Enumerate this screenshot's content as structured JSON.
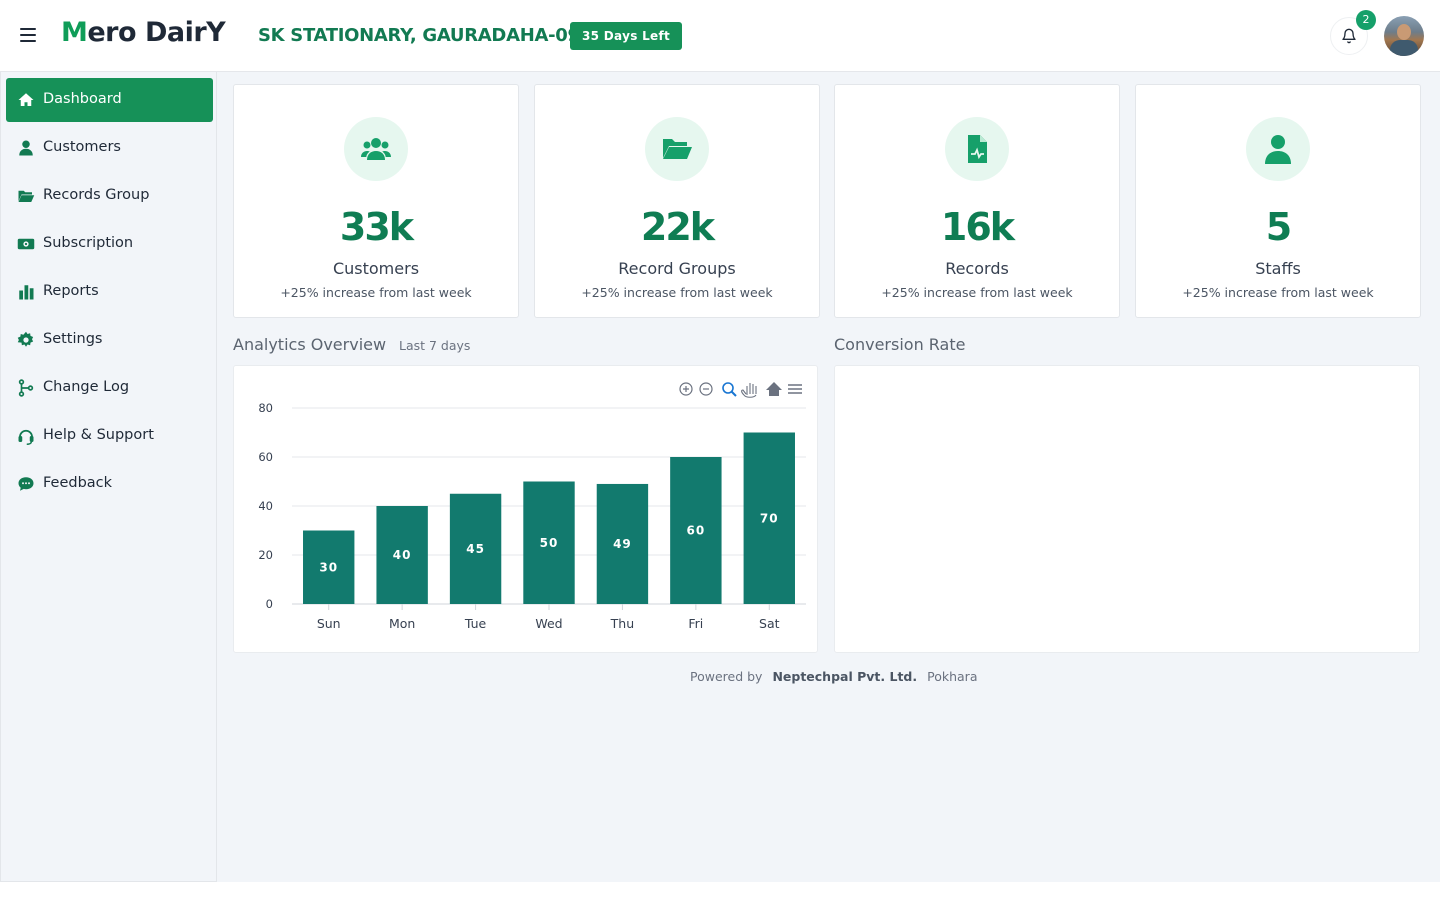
{
  "header": {
    "logo_initial": "M",
    "logo_rest": "ero DairY",
    "business_name": "SK STATIONARY, GAURADAHA-09",
    "days_left": "35 Days Left",
    "notification_count": "2"
  },
  "sidebar": {
    "items": [
      {
        "label": "Dashboard",
        "icon": "home-icon"
      },
      {
        "label": "Customers",
        "icon": "user-icon"
      },
      {
        "label": "Records Group",
        "icon": "folder-open-icon"
      },
      {
        "label": "Subscription",
        "icon": "money-bill-icon"
      },
      {
        "label": "Reports",
        "icon": "bar-chart-icon"
      },
      {
        "label": "Settings",
        "icon": "gear-icon"
      },
      {
        "label": "Change Log",
        "icon": "branch-icon"
      },
      {
        "label": "Help & Support",
        "icon": "headset-icon"
      },
      {
        "label": "Feedback",
        "icon": "chat-icon"
      }
    ]
  },
  "stats": [
    {
      "value": "33k",
      "label": "Customers",
      "sub": "+25% increase from last week",
      "icon": "users-icon"
    },
    {
      "value": "22k",
      "label": "Record Groups",
      "sub": "+25% increase from last week",
      "icon": "folder-open-icon"
    },
    {
      "value": "16k",
      "label": "Records",
      "sub": "+25% increase from last week",
      "icon": "file-medical-icon"
    },
    {
      "value": "5",
      "label": "Staffs",
      "sub": "+25% increase from last week",
      "icon": "user-icon"
    }
  ],
  "analytics": {
    "title": "Analytics Overview",
    "subtitle": "Last 7 days"
  },
  "conversion": {
    "title": "Conversion Rate"
  },
  "chart_data": {
    "type": "bar",
    "categories": [
      "Sun",
      "Mon",
      "Tue",
      "Wed",
      "Thu",
      "Fri",
      "Sat"
    ],
    "values": [
      30,
      40,
      45,
      50,
      49,
      60,
      70
    ],
    "yticks": [
      "0",
      "20",
      "40",
      "60",
      "80"
    ],
    "ylim": [
      0,
      80
    ],
    "title": "",
    "xlabel": "",
    "ylabel": "",
    "grid": true,
    "bar_color": "#127a6e",
    "data_labels": [
      "30",
      "40",
      "45",
      "50",
      "49",
      "60",
      "70"
    ]
  },
  "footer": {
    "powered_by": "Powered by",
    "company": "Neptechpal Pvt. Ltd.",
    "location": "Pokhara"
  },
  "colors": {
    "brand": "#169158",
    "accent_text": "#0f7d53",
    "background": "#f2f5f9"
  }
}
